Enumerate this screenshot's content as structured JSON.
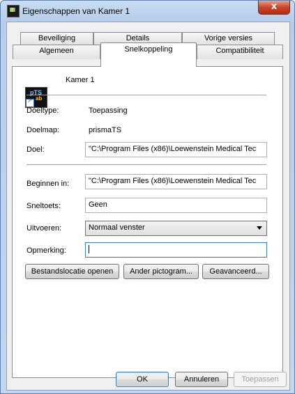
{
  "window": {
    "title": "Eigenschappen van Kamer 1",
    "close_symbol": "x"
  },
  "tabs": {
    "row1": [
      "Beveiliging",
      "Details",
      "Vorige versies"
    ],
    "row2": [
      "Algemeen",
      "Snelkoppeling",
      "Compatibiliteit"
    ],
    "active": "Snelkoppeling"
  },
  "shortcut": {
    "icon": "shortcut-app-icon",
    "icon_text_top": "pTS",
    "icon_text_bottom": "ab",
    "name": "Kamer 1"
  },
  "fields": {
    "doeltype_label": "Doeltype:",
    "doeltype_value": "Toepassing",
    "doelmap_label": "Doelmap:",
    "doelmap_value": "prismaTS",
    "doel_label": "Doel:",
    "doel_value": "\"C:\\Program Files (x86)\\Loewenstein Medical Tec",
    "beginnen_label": "Beginnen in:",
    "beginnen_value": "\"C:\\Program Files (x86)\\Loewenstein Medical Tec",
    "sneltoets_label": "Sneltoets:",
    "sneltoets_value": "Geen",
    "uitvoeren_label": "Uitvoeren:",
    "uitvoeren_value": "Normaal venster",
    "opmerking_label": "Opmerking:",
    "opmerking_value": ""
  },
  "actions": {
    "open_location": "Bestandslocatie openen",
    "change_icon": "Ander pictogram...",
    "advanced": "Geavanceerd..."
  },
  "footer": {
    "ok": "OK",
    "cancel": "Annuleren",
    "apply": "Toepassen"
  }
}
